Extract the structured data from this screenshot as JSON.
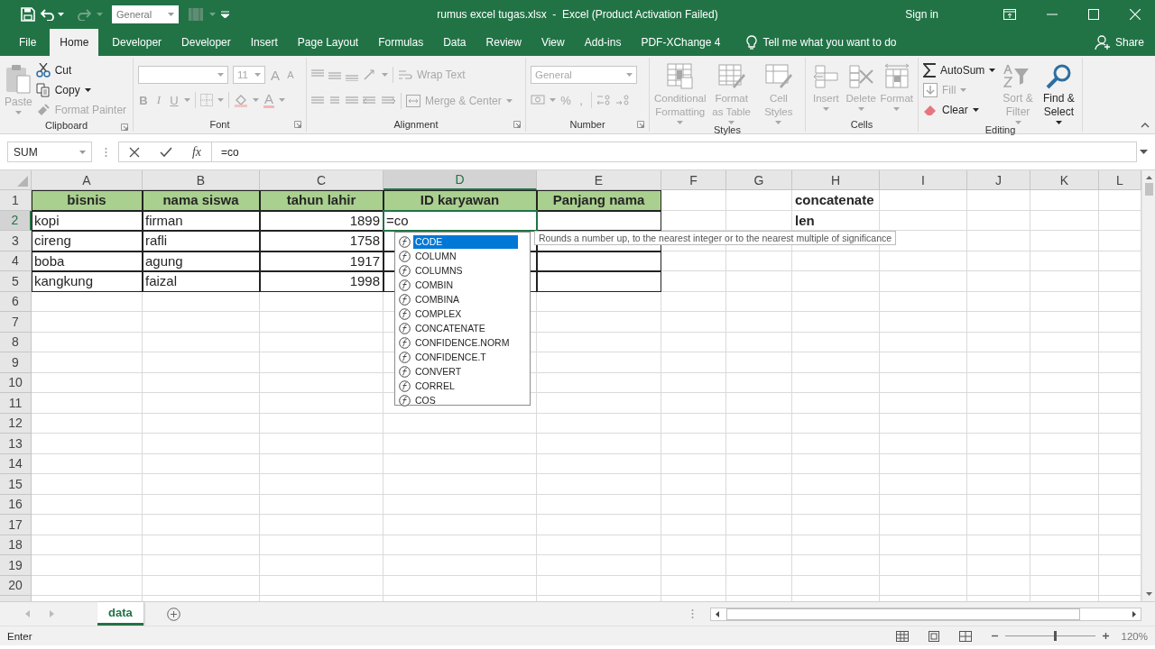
{
  "window": {
    "title": "rumus excel tugas.xlsx  -  Excel (Product Activation Failed)",
    "sign_in": "Sign in",
    "quick_font": "General"
  },
  "tabs": [
    {
      "label": "File",
      "selected": false
    },
    {
      "label": "Home",
      "selected": true
    },
    {
      "label": "Developer",
      "selected": false
    },
    {
      "label": "Developer",
      "selected": false
    },
    {
      "label": "Insert",
      "selected": false
    },
    {
      "label": "Page Layout",
      "selected": false
    },
    {
      "label": "Formulas",
      "selected": false
    },
    {
      "label": "Data",
      "selected": false
    },
    {
      "label": "Review",
      "selected": false
    },
    {
      "label": "View",
      "selected": false
    },
    {
      "label": "Add-ins",
      "selected": false
    },
    {
      "label": "PDF-XChange 4",
      "selected": false
    }
  ],
  "tell_me": "Tell me what you want to do",
  "share": "Share",
  "ribbon": {
    "clipboard": {
      "label": "Clipboard",
      "paste": {
        "label": "Paste",
        "disabled": true
      },
      "cut": {
        "label": "Cut",
        "disabled": false
      },
      "copy": {
        "label": "Copy",
        "disabled": false
      },
      "format_painter": {
        "label": "Format Painter",
        "disabled": true
      }
    },
    "font": {
      "label": "Font",
      "disabled": true,
      "size": "11",
      "grow": "A",
      "shrink": "A",
      "bold": "B",
      "italic": "I",
      "underline": "U",
      "font_color_button": "A"
    },
    "alignment": {
      "label": "Alignment",
      "disabled": true,
      "wrap_text": "Wrap Text",
      "merge": "Merge & Center"
    },
    "number": {
      "label": "Number",
      "disabled": true,
      "format": "General",
      "percent": "%",
      "comma": ","
    },
    "styles": {
      "label": "Styles",
      "items": [
        {
          "label": "Conditional Formatting",
          "disabled": true
        },
        {
          "label": "Format as Table",
          "disabled": true
        },
        {
          "label": "Cell Styles",
          "disabled": true
        }
      ]
    },
    "cells": {
      "label": "Cells",
      "items": [
        {
          "label": "Insert",
          "disabled": true
        },
        {
          "label": "Delete",
          "disabled": true
        },
        {
          "label": "Format",
          "disabled": true
        }
      ]
    },
    "editing": {
      "label": "Editing",
      "autosum": {
        "label": "AutoSum",
        "disabled": false
      },
      "fill": {
        "label": "Fill",
        "disabled": true
      },
      "clear": {
        "label": "Clear",
        "disabled": false
      },
      "sort": {
        "label": "Sort & Filter",
        "disabled": true
      },
      "find": {
        "label": "Find & Select",
        "disabled": false
      }
    }
  },
  "formula_bar": {
    "name_box": "SUM",
    "function_button": "fx",
    "formula": "=co"
  },
  "grid": {
    "columns": [
      {
        "label": "A",
        "selected": false
      },
      {
        "label": "B",
        "selected": false
      },
      {
        "label": "C",
        "selected": false
      },
      {
        "label": "D",
        "selected": true
      },
      {
        "label": "E",
        "selected": false
      },
      {
        "label": "F",
        "selected": false
      },
      {
        "label": "G",
        "selected": false
      },
      {
        "label": "H",
        "selected": false
      },
      {
        "label": "I",
        "selected": false
      },
      {
        "label": "J",
        "selected": false
      },
      {
        "label": "K",
        "selected": false
      },
      {
        "label": "L",
        "selected": false
      }
    ],
    "rows": [
      {
        "label": "1",
        "selected": false,
        "cells": [
          {
            "kind": "header",
            "text": "bisnis",
            "bordered": true
          },
          {
            "kind": "header",
            "text": "nama siswa",
            "bordered": true
          },
          {
            "kind": "header",
            "text": "tahun lahir",
            "bordered": true
          },
          {
            "kind": "header",
            "text": "ID karyawan",
            "bordered": true
          },
          {
            "kind": "header",
            "text": "Panjang nama",
            "bordered": true
          },
          {
            "kind": "text",
            "bordered": false
          },
          {
            "kind": "text",
            "bordered": false
          },
          {
            "kind": "label",
            "text": "concatenate",
            "bordered": false
          }
        ]
      },
      {
        "label": "2",
        "selected": true,
        "cells": [
          {
            "kind": "text",
            "text": "kopi",
            "bordered": true
          },
          {
            "kind": "text",
            "text": "firman",
            "bordered": true
          },
          {
            "kind": "number",
            "text": "1899",
            "bordered": true
          },
          {
            "kind": "editing",
            "text": "=co"
          },
          {
            "kind": "text",
            "bordered": true
          },
          {
            "kind": "text",
            "bordered": false
          },
          {
            "kind": "text",
            "bordered": false
          },
          {
            "kind": "label",
            "text": "len",
            "bordered": false
          }
        ]
      },
      {
        "label": "3",
        "selected": false,
        "cells": [
          {
            "kind": "text",
            "text": "cireng",
            "bordered": true
          },
          {
            "kind": "text",
            "text": "rafli",
            "bordered": true
          },
          {
            "kind": "number",
            "text": "1758",
            "bordered": true
          },
          {
            "kind": "text",
            "bordered": true
          },
          {
            "kind": "text",
            "bordered": true
          }
        ]
      },
      {
        "label": "4",
        "selected": false,
        "cells": [
          {
            "kind": "text",
            "text": "boba",
            "bordered": true
          },
          {
            "kind": "text",
            "text": "agung",
            "bordered": true
          },
          {
            "kind": "number",
            "text": "1917",
            "bordered": true
          },
          {
            "kind": "text",
            "bordered": true
          },
          {
            "kind": "text",
            "bordered": true
          }
        ]
      },
      {
        "label": "5",
        "selected": false,
        "cells": [
          {
            "kind": "text",
            "text": "kangkung",
            "bordered": true
          },
          {
            "kind": "text",
            "text": "faizal",
            "bordered": true
          },
          {
            "kind": "number",
            "text": "1998",
            "bordered": true
          },
          {
            "kind": "text",
            "bordered": true
          },
          {
            "kind": "text",
            "bordered": true
          }
        ]
      },
      {
        "label": "6",
        "selected": false
      },
      {
        "label": "7",
        "selected": false
      },
      {
        "label": "8",
        "selected": false
      },
      {
        "label": "9",
        "selected": false
      },
      {
        "label": "10",
        "selected": false
      },
      {
        "label": "11",
        "selected": false
      },
      {
        "label": "12",
        "selected": false
      },
      {
        "label": "13",
        "selected": false
      },
      {
        "label": "14",
        "selected": false
      },
      {
        "label": "15",
        "selected": false
      },
      {
        "label": "16",
        "selected": false
      },
      {
        "label": "17",
        "selected": false
      },
      {
        "label": "18",
        "selected": false
      },
      {
        "label": "19",
        "selected": false
      },
      {
        "label": "20",
        "selected": false
      }
    ]
  },
  "autocomplete": {
    "items": [
      {
        "label": "CODE",
        "selected": true
      },
      {
        "label": "COLUMN",
        "selected": false
      },
      {
        "label": "COLUMNS",
        "selected": false
      },
      {
        "label": "COMBIN",
        "selected": false
      },
      {
        "label": "COMBINA",
        "selected": false
      },
      {
        "label": "COMPLEX",
        "selected": false
      },
      {
        "label": "CONCATENATE",
        "selected": false
      },
      {
        "label": "CONFIDENCE.NORM",
        "selected": false
      },
      {
        "label": "CONFIDENCE.T",
        "selected": false
      },
      {
        "label": "CONVERT",
        "selected": false
      },
      {
        "label": "CORREL",
        "selected": false
      },
      {
        "label": "COS",
        "selected": false
      }
    ],
    "tooltip": "Rounds a number up, to the nearest integer or to the nearest multiple of significance"
  },
  "sheet_tabs": [
    {
      "label": "data",
      "selected": true
    }
  ],
  "status_bar": {
    "mode": "Enter",
    "zoom": "120%",
    "zoom_slider": {
      "level": 0.55
    }
  }
}
